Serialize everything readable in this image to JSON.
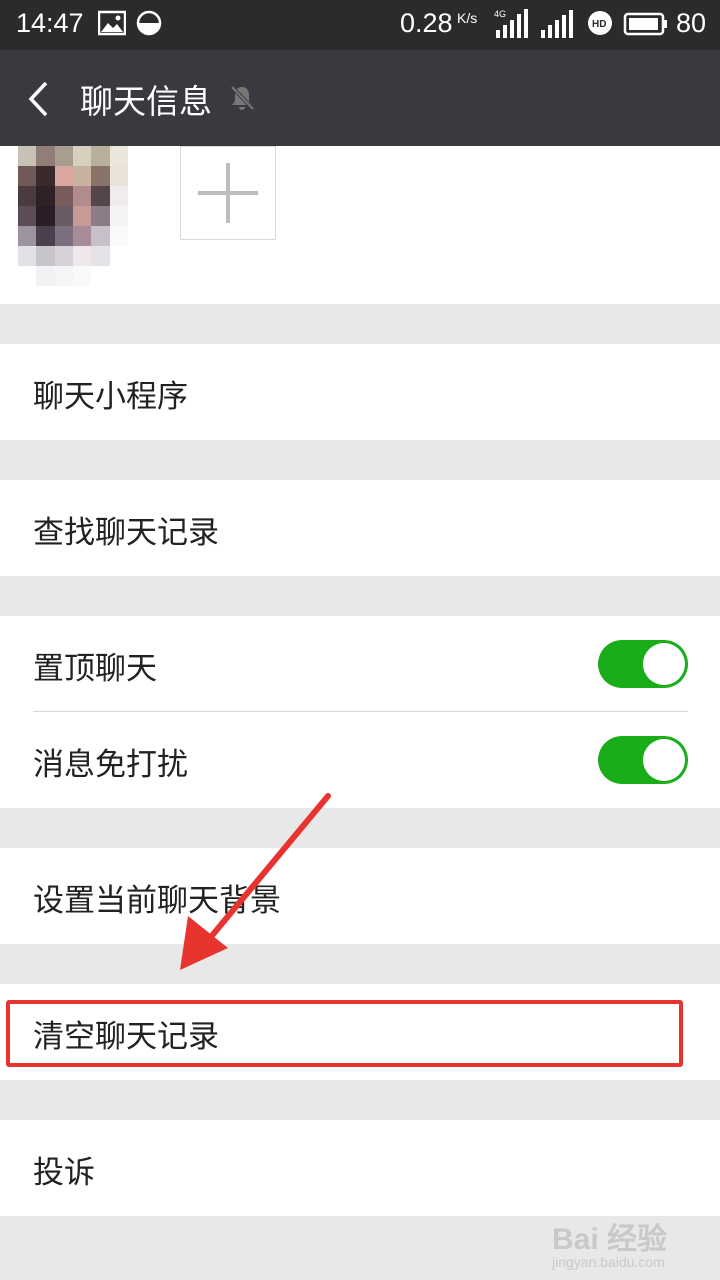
{
  "status_bar": {
    "time": "14:47",
    "speed": "0.28",
    "speed_unit": "K/s",
    "network": "4G",
    "battery": "80"
  },
  "nav": {
    "title": "聊天信息"
  },
  "cells": {
    "mini_program": "聊天小程序",
    "search_history": "查找聊天记录",
    "sticky_chat": "置顶聊天",
    "mute_notifications": "消息免打扰",
    "set_background": "设置当前聊天背景",
    "clear_history": "清空聊天记录",
    "report": "投诉"
  },
  "toggles": {
    "sticky_chat_on": true,
    "mute_notifications_on": true
  },
  "watermark": {
    "brand": "Bai 经验",
    "sub": "jingyan.baidu.com"
  },
  "colors": {
    "nav_bg": "#393a3f",
    "status_bg": "#2b2b2b",
    "toggle_on": "#1aad19",
    "annotation_red": "#e8342f",
    "page_bg": "#e8e8e8"
  }
}
